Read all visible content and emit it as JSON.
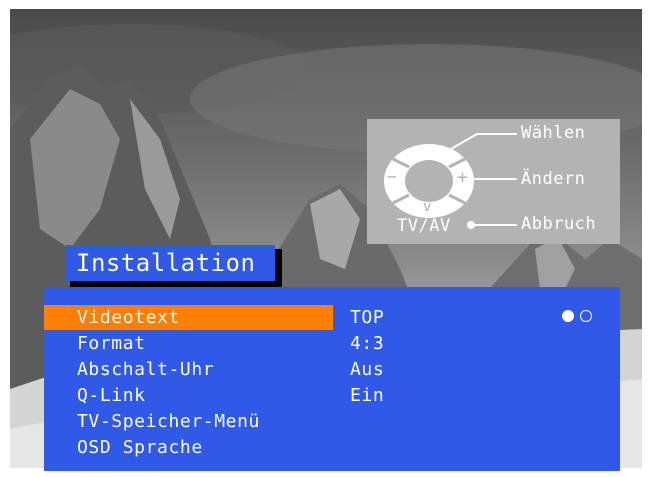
{
  "help": {
    "select_label": "Wählen",
    "change_label": "Ändern",
    "cancel_label": "Abbruch",
    "tvav_label": "TV/AV",
    "up_symbol": "^",
    "down_symbol": "v",
    "minus_symbol": "−",
    "plus_symbol": "+"
  },
  "menu": {
    "title": "Installation",
    "items": [
      {
        "label": "Videotext",
        "value": "TOP",
        "selected": true
      },
      {
        "label": "Format",
        "value": "4:3"
      },
      {
        "label": "Abschalt-Uhr",
        "value": "Aus"
      },
      {
        "label": "Q-Link",
        "value": "Ein"
      },
      {
        "label": "TV-Speicher-Menü",
        "value": ""
      },
      {
        "label": "OSD Sprache",
        "value": ""
      }
    ],
    "page_indicator": {
      "current": 1,
      "total": 2
    }
  },
  "colors": {
    "menu_bg": "#2f59e6",
    "highlight": "#ff7f00",
    "text": "#ffffff",
    "help_bg": "#b3b3b3"
  }
}
